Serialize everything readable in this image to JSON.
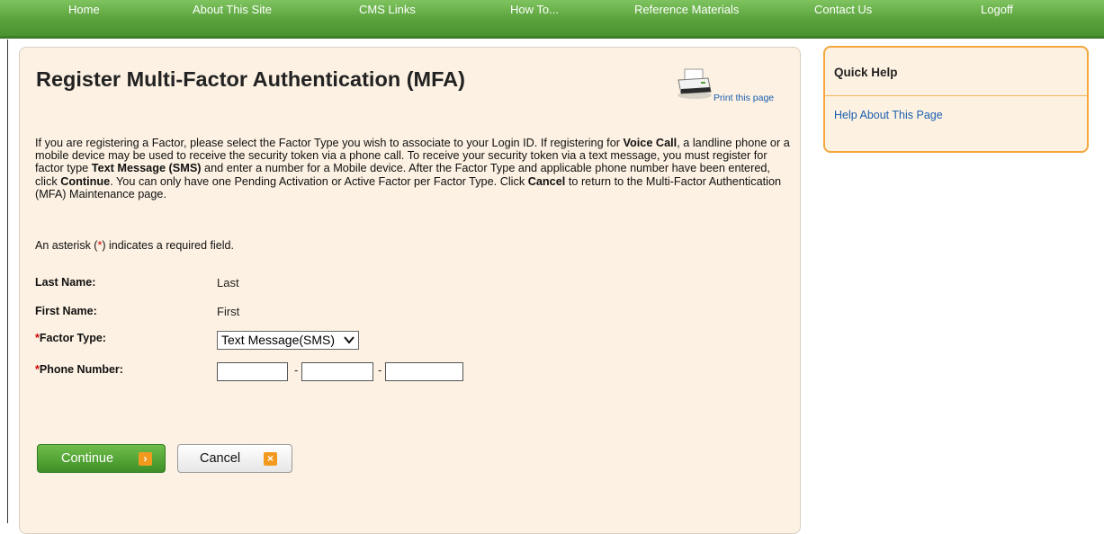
{
  "nav": {
    "items": [
      "Home",
      "About This Site",
      "CMS Links",
      "How To...",
      "Reference Materials",
      "Contact Us",
      "Logoff"
    ]
  },
  "colors": {
    "nav_green": "#5aa23b",
    "panel_bg": "#fcf1e2",
    "accent_orange": "#f4a73d",
    "link_blue": "#1a5fb0",
    "required_red": "#d00000"
  },
  "page": {
    "title": "Register Multi-Factor Authentication (MFA)",
    "print_link": "Print this page",
    "print_icon": "printer-icon",
    "intro": [
      {
        "t": "If you are registering a Factor, please select the Factor Type you wish to associate to your Login ID. If registering for ",
        "b": false
      },
      {
        "t": "Voice Call",
        "b": true
      },
      {
        "t": ", a landline phone or a mobile device may be used to receive the security token via a phone call. To receive your security token via a text message, you must register for factor type ",
        "b": false
      },
      {
        "t": "Text Message (SMS)",
        "b": true
      },
      {
        "t": " and enter a number for a Mobile device. After the Factor Type and applicable phone number have been entered, click ",
        "b": false
      },
      {
        "t": "Continue",
        "b": true
      },
      {
        "t": ". You can only have one Pending Activation or Active Factor per Factor Type. Click ",
        "b": false
      },
      {
        "t": "Cancel",
        "b": true
      },
      {
        "t": " to return to the Multi-Factor Authentication (MFA) Maintenance page.",
        "b": false
      }
    ],
    "required_note_pre": "An asterisk (",
    "required_note_star": "*",
    "required_note_post": ") indicates a required field."
  },
  "form": {
    "last_name_label": "Last Name:",
    "last_name_value": "Last",
    "first_name_label": "First Name:",
    "first_name_value": "First",
    "required_star": "*",
    "factor_type_label": "Factor Type:",
    "factor_type_value": "Text Message(SMS)",
    "phone_label": "Phone Number:",
    "phone_separator": "-",
    "phone_parts": [
      "",
      "",
      ""
    ]
  },
  "buttons": {
    "continue_label": "Continue",
    "continue_icon": "arrow-right-icon",
    "cancel_label": "Cancel",
    "cancel_icon": "close-icon"
  },
  "quick_help": {
    "title": "Quick Help",
    "link": "Help About This Page"
  }
}
